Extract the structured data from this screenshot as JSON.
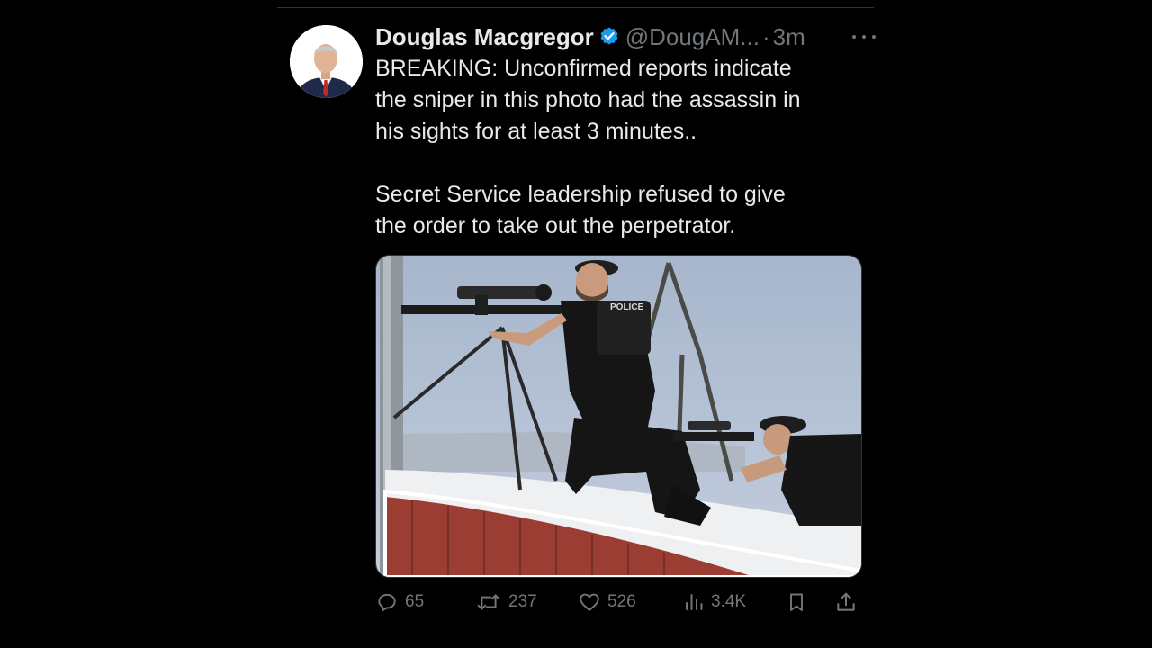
{
  "tweet": {
    "author": {
      "display_name": "Douglas Macgregor",
      "handle": "@DougAM...",
      "verified": true,
      "verified_color": "#1d9bf0"
    },
    "separator": "·",
    "time": "3m",
    "text_paragraph_1": [
      "BREAKING: Unconfirmed reports indicate",
      "the sniper in this photo had the assassin in",
      "his sights for at least 3 minutes.."
    ],
    "text_paragraph_2": [
      "Secret Service leadership refused to give",
      "the order to take out the perpetrator."
    ],
    "media_vest_text": "POLICE",
    "actions": {
      "replies": "65",
      "reposts": "237",
      "likes": "526",
      "views": "3.4K"
    },
    "icons": {
      "reply": "reply-icon",
      "repost": "repost-icon",
      "like": "heart-icon",
      "views": "views-icon",
      "bookmark": "bookmark-icon",
      "share": "share-icon",
      "more": "more-icon"
    }
  }
}
